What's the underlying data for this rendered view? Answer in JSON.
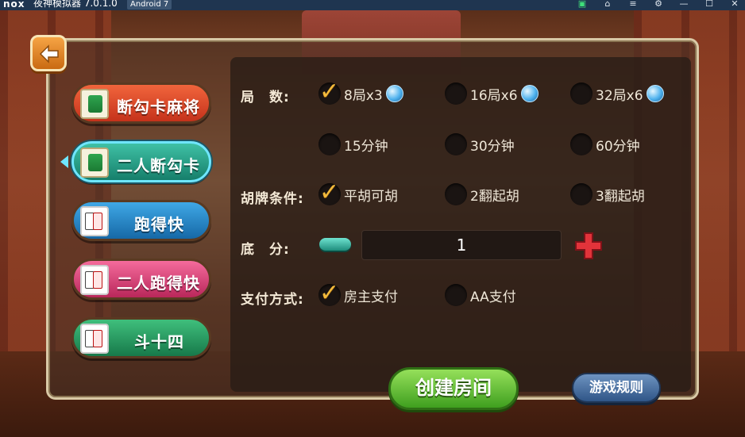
{
  "titlebar": {
    "logo": "nox",
    "title": "夜神模拟器 7.0.1.0",
    "badge": "Android 7"
  },
  "games": [
    {
      "label": "断勾卡麻将",
      "selected": false
    },
    {
      "label": "二人断勾卡",
      "selected": true
    },
    {
      "label": "跑得快",
      "selected": false
    },
    {
      "label": "二人跑得快",
      "selected": false
    },
    {
      "label": "斗十四",
      "selected": false
    }
  ],
  "rounds": {
    "label": "局　数:",
    "options": [
      {
        "label": "8局x3",
        "checked": true
      },
      {
        "label": "16局x6",
        "checked": false
      },
      {
        "label": "32局x6",
        "checked": false
      }
    ],
    "time_options": [
      {
        "label": "15分钟",
        "checked": false
      },
      {
        "label": "30分钟",
        "checked": false
      },
      {
        "label": "60分钟",
        "checked": false
      }
    ]
  },
  "hu": {
    "label": "胡牌条件:",
    "options": [
      {
        "label": "平胡可胡",
        "checked": true
      },
      {
        "label": "2翻起胡",
        "checked": false
      },
      {
        "label": "3翻起胡",
        "checked": false
      }
    ]
  },
  "base_score": {
    "label": "底　分:",
    "value": "1"
  },
  "payment": {
    "label": "支付方式:",
    "options": [
      {
        "label": "房主支付",
        "checked": true
      },
      {
        "label": "AA支付",
        "checked": false
      }
    ]
  },
  "buttons": {
    "create": "创建房间",
    "rules": "游戏规则"
  }
}
